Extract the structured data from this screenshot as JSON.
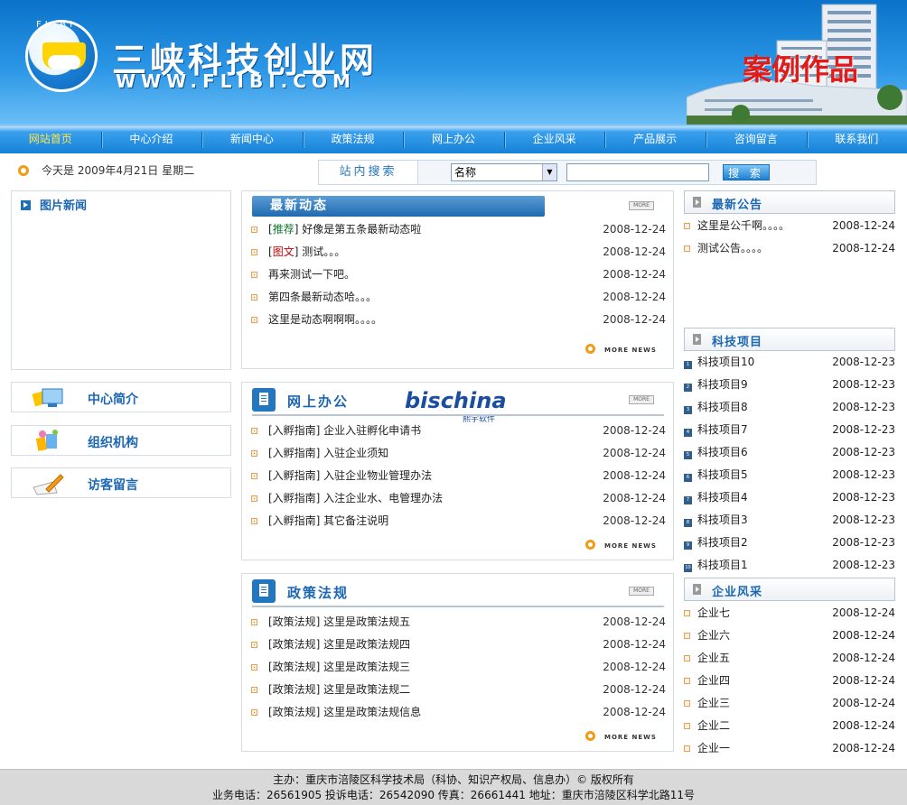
{
  "header": {
    "logo_ring_text": "FLIBI",
    "site_name": "三峡科技创业网",
    "site_url": "WWW.FLIBI.COM",
    "slogan": "案例作品"
  },
  "nav": [
    "网站首页",
    "中心介绍",
    "新闻中心",
    "政策法规",
    "网上办公",
    "企业风采",
    "产品展示",
    "咨询留言",
    "联系我们"
  ],
  "nav_active_index": 0,
  "date_text": "今天是 2009年4月21日 星期二",
  "search": {
    "label": "站内搜索",
    "select_value": "名称",
    "input_value": "",
    "button_label": "搜 索"
  },
  "pic_news": {
    "title": "图片新闻"
  },
  "side_links": [
    {
      "label": "中心简介",
      "icon": "monitor-icon"
    },
    {
      "label": "组织机构",
      "icon": "people-icon"
    },
    {
      "label": "访客留言",
      "icon": "pencil-icon"
    }
  ],
  "news": {
    "title": "最新动态",
    "more_label": "MORE",
    "more_news_label": "MORE NEWS",
    "items": [
      {
        "tag": "推荐",
        "tag_color": "green",
        "text": "好像是第五条最新动态啦",
        "date": "2008-12-24"
      },
      {
        "tag": "图文",
        "tag_color": "red",
        "text": "测试。。。",
        "date": "2008-12-24"
      },
      {
        "tag": "",
        "text": "再来测试一下吧。",
        "date": "2008-12-24"
      },
      {
        "tag": "",
        "text": "第四条最新动态哈。。。",
        "date": "2008-12-24"
      },
      {
        "tag": "",
        "text": "这里是动态啊啊啊。。。。",
        "date": "2008-12-24"
      }
    ]
  },
  "office": {
    "title": "网上办公",
    "watermark": "bischina",
    "watermark_sub": "熙宇软件",
    "more_label": "MORE",
    "more_news_label": "MORE NEWS",
    "items": [
      {
        "text": "[入孵指南] 企业入驻孵化申请书",
        "date": "2008-12-24"
      },
      {
        "text": "[入孵指南] 入驻企业须知",
        "date": "2008-12-24"
      },
      {
        "text": "[入孵指南] 入驻企业物业管理办法",
        "date": "2008-12-24"
      },
      {
        "text": "[入孵指南] 入注企业水、电管理办法",
        "date": "2008-12-24"
      },
      {
        "text": "[入孵指南] 其它备注说明",
        "date": "2008-12-24"
      }
    ]
  },
  "policy": {
    "title": "政策法规",
    "more_label": "MORE",
    "more_news_label": "MORE NEWS",
    "items": [
      {
        "text": "[政策法规] 这里是政策法规五",
        "date": "2008-12-24"
      },
      {
        "text": "[政策法规] 这里是政策法规四",
        "date": "2008-12-24"
      },
      {
        "text": "[政策法规] 这里是政策法规三",
        "date": "2008-12-24"
      },
      {
        "text": "[政策法规] 这里是政策法规二",
        "date": "2008-12-24"
      },
      {
        "text": "[政策法规] 这里是政策法规信息",
        "date": "2008-12-24"
      }
    ]
  },
  "announcements": {
    "title": "最新公告",
    "items": [
      {
        "text": "这里是公千啊。。。。",
        "date": "2008-12-24"
      },
      {
        "text": "测试公告。。。。",
        "date": "2008-12-24"
      }
    ]
  },
  "projects": {
    "title": "科技项目",
    "items": [
      {
        "num": "1",
        "text": "科技项目10",
        "date": "2008-12-23"
      },
      {
        "num": "2",
        "text": "科技项目9",
        "date": "2008-12-23"
      },
      {
        "num": "3",
        "text": "科技项目8",
        "date": "2008-12-23"
      },
      {
        "num": "4",
        "text": "科技项目7",
        "date": "2008-12-23"
      },
      {
        "num": "5",
        "text": "科技项目6",
        "date": "2008-12-23"
      },
      {
        "num": "6",
        "text": "科技项目5",
        "date": "2008-12-23"
      },
      {
        "num": "7",
        "text": "科技项目4",
        "date": "2008-12-23"
      },
      {
        "num": "8",
        "text": "科技项目3",
        "date": "2008-12-23"
      },
      {
        "num": "9",
        "text": "科技项目2",
        "date": "2008-12-23"
      },
      {
        "num": "10",
        "text": "科技项目1",
        "date": "2008-12-23"
      }
    ]
  },
  "enterprises": {
    "title": "企业风采",
    "items": [
      {
        "text": "企业七",
        "date": "2008-12-24"
      },
      {
        "text": "企业六",
        "date": "2008-12-24"
      },
      {
        "text": "企业五",
        "date": "2008-12-24"
      },
      {
        "text": "企业四",
        "date": "2008-12-24"
      },
      {
        "text": "企业三",
        "date": "2008-12-24"
      },
      {
        "text": "企业二",
        "date": "2008-12-24"
      },
      {
        "text": "企业一",
        "date": "2008-12-24"
      }
    ]
  },
  "footer": {
    "line1": "主办：重庆市涪陵区科学技术局（科协、知识产权局、信息办）© 版权所有",
    "line2": "业务电话：26561905 投诉电话：26542090 传真：26661441 地址：重庆市涪陵区科学北路11号"
  },
  "colors": {
    "header_blue": "#0a73c9",
    "nav_blue": "#1581d6",
    "nav_active": "#ffe64d",
    "title_blue": "#1c67b3",
    "slogan_red": "#e11a1a",
    "accent_orange": "#f39a17"
  }
}
